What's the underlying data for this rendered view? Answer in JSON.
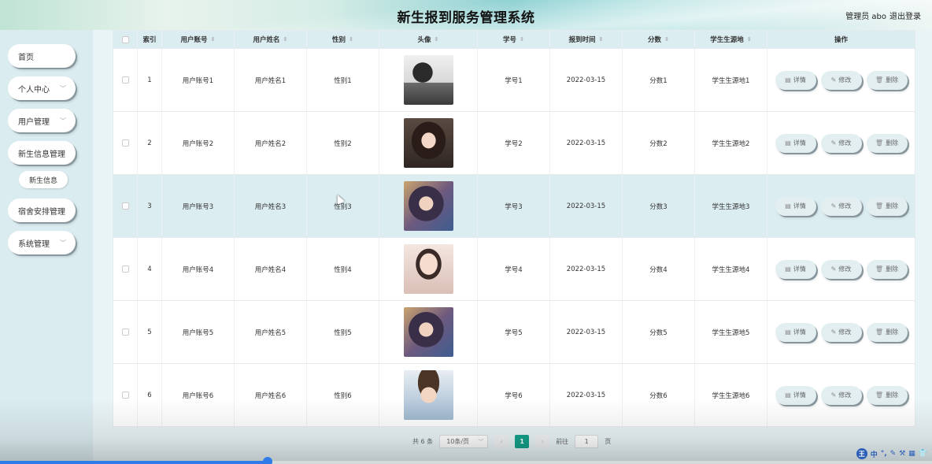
{
  "header": {
    "title": "新生报到服务管理系统",
    "user": "管理员 abo",
    "logout": "退出登录"
  },
  "sidebar": {
    "items": [
      {
        "label": "首页",
        "chevron": false
      },
      {
        "label": "个人中心",
        "chevron": true
      },
      {
        "label": "用户管理",
        "chevron": true
      },
      {
        "label": "新生信息管理",
        "chevron": false
      },
      {
        "label": "宿舍安排管理",
        "chevron": false
      },
      {
        "label": "系统管理",
        "chevron": true
      }
    ],
    "sub_item": "新生信息"
  },
  "table": {
    "columns": [
      "索引",
      "用户账号",
      "用户姓名",
      "性别",
      "头像",
      "学号",
      "报到时间",
      "分数",
      "学生生源地",
      "操作"
    ],
    "rows": [
      {
        "index": "1",
        "account": "用户账号1",
        "name": "用户姓名1",
        "gender": "性别1",
        "student_no": "学号1",
        "date": "2022-03-15",
        "score": "分数1",
        "origin": "学生生源地1"
      },
      {
        "index": "2",
        "account": "用户账号2",
        "name": "用户姓名2",
        "gender": "性别2",
        "student_no": "学号2",
        "date": "2022-03-15",
        "score": "分数2",
        "origin": "学生生源地2"
      },
      {
        "index": "3",
        "account": "用户账号3",
        "name": "用户姓名3",
        "gender": "性别3",
        "student_no": "学号3",
        "date": "2022-03-15",
        "score": "分数3",
        "origin": "学生生源地3"
      },
      {
        "index": "4",
        "account": "用户账号4",
        "name": "用户姓名4",
        "gender": "性别4",
        "student_no": "学号4",
        "date": "2022-03-15",
        "score": "分数4",
        "origin": "学生生源地4"
      },
      {
        "index": "5",
        "account": "用户账号5",
        "name": "用户姓名5",
        "gender": "性别5",
        "student_no": "学号5",
        "date": "2022-03-15",
        "score": "分数5",
        "origin": "学生生源地5"
      },
      {
        "index": "6",
        "account": "用户账号6",
        "name": "用户姓名6",
        "gender": "性别6",
        "student_no": "学号6",
        "date": "2022-03-15",
        "score": "分数6",
        "origin": "学生生源地6"
      }
    ],
    "actions": {
      "detail": "详情",
      "edit": "修改",
      "delete": "删除"
    }
  },
  "pagination": {
    "total": "共 6 条",
    "page_size": "10条/页",
    "current_page": "1",
    "goto_label": "前往",
    "goto_value": "1",
    "page_unit": "页"
  },
  "colors": {
    "accent": "#14a08a",
    "row_highlight": "#dcedf1"
  }
}
